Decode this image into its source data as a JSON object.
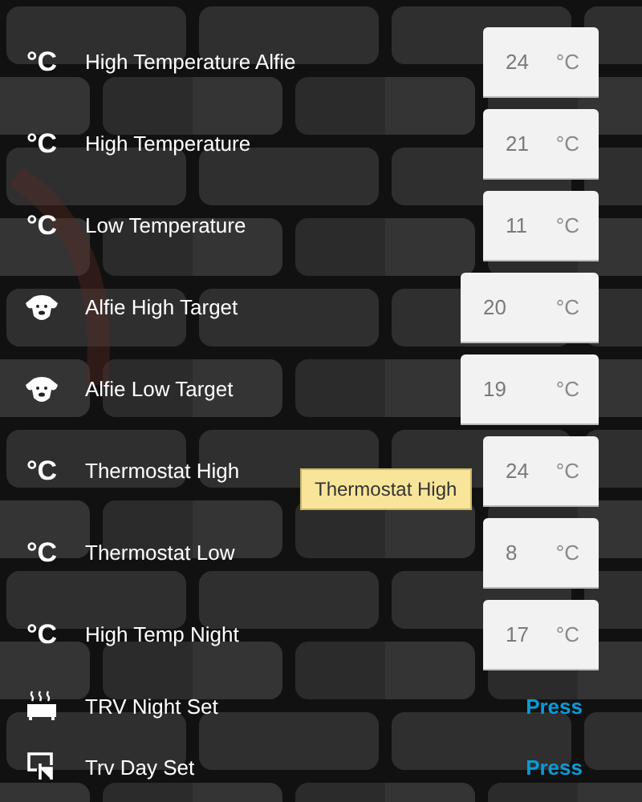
{
  "rows": [
    {
      "kind": "number",
      "icon": "°C",
      "label": "High Temperature Alfie",
      "value": "24",
      "unit": "°C",
      "wide": false
    },
    {
      "kind": "number",
      "icon": "°C",
      "label": "High Temperature",
      "value": "21",
      "unit": "°C",
      "wide": false
    },
    {
      "kind": "number",
      "icon": "°C",
      "label": "Low Temperature",
      "value": "11",
      "unit": "°C",
      "wide": false
    },
    {
      "kind": "number",
      "label": "Alfie High Target",
      "value": "20",
      "unit": "°C",
      "wide": true
    },
    {
      "kind": "number",
      "label": "Alfie Low Target",
      "value": "19",
      "unit": "°C",
      "wide": true
    },
    {
      "kind": "number",
      "icon": "°C",
      "label": "Thermostat High",
      "value": "24",
      "unit": "°C",
      "wide": false,
      "tooltip": "Thermostat High"
    },
    {
      "kind": "number",
      "icon": "°C",
      "label": "Thermostat Low",
      "value": "8",
      "unit": "°C",
      "wide": false
    },
    {
      "kind": "number",
      "icon": "°C",
      "label": "High Temp Night",
      "value": "17",
      "unit": "°C",
      "wide": false
    },
    {
      "kind": "button",
      "label": "TRV Night Set",
      "action": "Press"
    },
    {
      "kind": "button",
      "label": "Trv Day Set",
      "action": "Press"
    }
  ]
}
